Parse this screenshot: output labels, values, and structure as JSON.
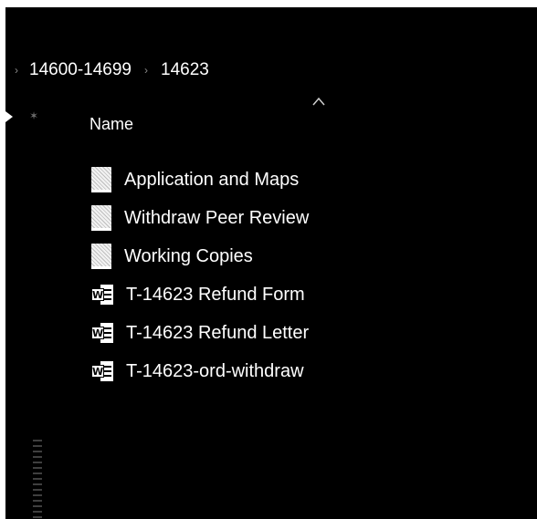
{
  "breadcrumb": {
    "items": [
      {
        "label": "14600-14699"
      },
      {
        "label": "14623"
      }
    ]
  },
  "file_list": {
    "column_header": "Name",
    "items": [
      {
        "name": "Application and Maps",
        "type": "folder",
        "icon": "folder-icon"
      },
      {
        "name": "Withdraw Peer Review",
        "type": "folder",
        "icon": "folder-icon"
      },
      {
        "name": "Working Copies",
        "type": "folder",
        "icon": "folder-icon"
      },
      {
        "name": "T-14623 Refund Form",
        "type": "word-document",
        "icon": "word-document-icon"
      },
      {
        "name": "T-14623 Refund Letter",
        "type": "word-document",
        "icon": "word-document-icon"
      },
      {
        "name": "T-14623-ord-withdraw",
        "type": "word-document",
        "icon": "word-document-icon"
      }
    ]
  },
  "colors": {
    "background": "#000000",
    "text": "#ffffff",
    "separator": "#8a8a8a"
  }
}
